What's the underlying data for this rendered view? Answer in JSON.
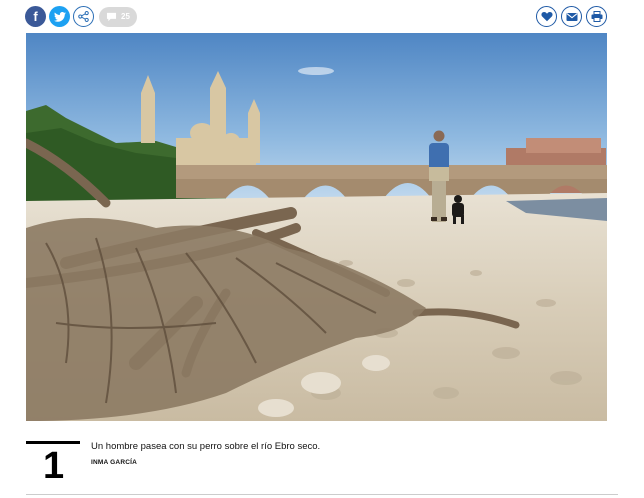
{
  "toolbar": {
    "left_buttons": [
      {
        "name": "facebook",
        "icon": "facebook-icon",
        "glyph": "f"
      },
      {
        "name": "twitter",
        "icon": "twitter-icon"
      },
      {
        "name": "share",
        "icon": "share-icon"
      }
    ],
    "comments": {
      "icon": "comment-icon",
      "count": "25"
    },
    "right_buttons": [
      {
        "name": "favorite",
        "icon": "heart-icon"
      },
      {
        "name": "email",
        "icon": "envelope-icon"
      },
      {
        "name": "print",
        "icon": "printer-icon"
      }
    ],
    "colors": {
      "facebook": "#3b5998",
      "twitter": "#1da1f2",
      "outline": "#1f5aa6",
      "pill": "#d9d9d9"
    }
  },
  "photo": {
    "subject": "Man walking a dog across the dry riverbed of the Ebro, with exposed roots in the foreground and the Basilica del Pilar behind"
  },
  "gallery": {
    "index": "1",
    "caption": "Un hombre pasea con su perro sobre el río Ebro seco.",
    "credit": "INMA GARCÍA"
  }
}
